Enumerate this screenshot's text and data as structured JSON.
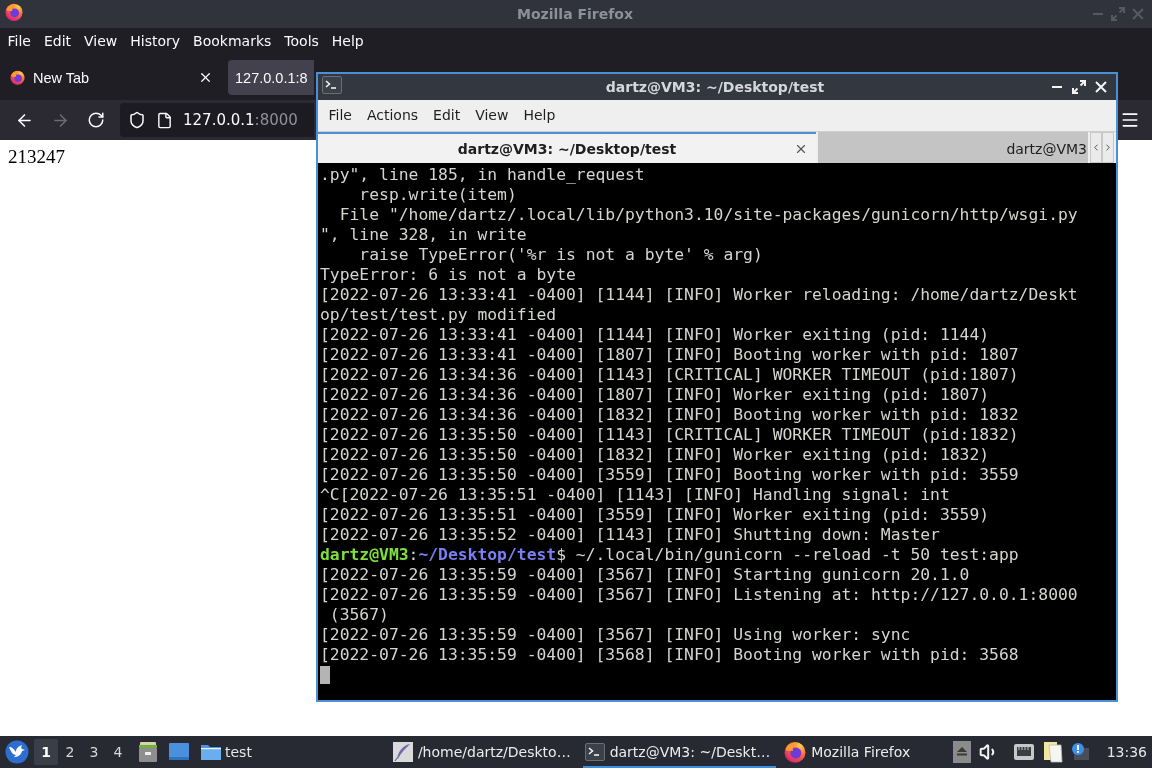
{
  "firefox": {
    "title": "Mozilla Firefox",
    "menu": [
      "File",
      "Edit",
      "View",
      "History",
      "Bookmarks",
      "Tools",
      "Help"
    ],
    "tabs": [
      {
        "label": "New Tab",
        "selected": false,
        "close_button": true
      },
      {
        "label": "127.0.0.1:8",
        "selected": true,
        "close_button": false
      }
    ],
    "nav": {
      "back": {
        "disabled": false
      },
      "forward": {
        "disabled": true
      },
      "url": {
        "host": "127.0.0.1",
        "port": ":8000"
      }
    },
    "page": {
      "text": "213247"
    }
  },
  "terminal": {
    "title": "dartz@VM3: ~/Desktop/test",
    "menu": [
      "File",
      "Actions",
      "Edit",
      "View",
      "Help"
    ],
    "tabs": [
      {
        "label": "dartz@VM3: ~/Desktop/test",
        "selected": true,
        "close_button": true
      },
      {
        "label": "dartz@VM3",
        "selected": false,
        "close_button": false
      }
    ],
    "lines": [
      {
        "kind": "output",
        "text": ".py\", line 185, in handle_request"
      },
      {
        "kind": "output",
        "text": "    resp.write(item)"
      },
      {
        "kind": "output",
        "text": "  File \"/home/dartz/.local/lib/python3.10/site-packages/gunicorn/http/wsgi.py"
      },
      {
        "kind": "output",
        "text": "\", line 328, in write"
      },
      {
        "kind": "output",
        "text": "    raise TypeError('%r is not a byte' % arg)"
      },
      {
        "kind": "output",
        "text": "TypeError: 6 is not a byte"
      },
      {
        "kind": "output",
        "text": "[2022-07-26 13:33:41 -0400] [1144] [INFO] Worker reloading: /home/dartz/Deskt"
      },
      {
        "kind": "output",
        "text": "op/test/test.py modified"
      },
      {
        "kind": "output",
        "text": "[2022-07-26 13:33:41 -0400] [1144] [INFO] Worker exiting (pid: 1144)"
      },
      {
        "kind": "output",
        "text": "[2022-07-26 13:33:41 -0400] [1807] [INFO] Booting worker with pid: 1807"
      },
      {
        "kind": "output",
        "text": "[2022-07-26 13:34:36 -0400] [1143] [CRITICAL] WORKER TIMEOUT (pid:1807)"
      },
      {
        "kind": "output",
        "text": "[2022-07-26 13:34:36 -0400] [1807] [INFO] Worker exiting (pid: 1807)"
      },
      {
        "kind": "output",
        "text": "[2022-07-26 13:34:36 -0400] [1832] [INFO] Booting worker with pid: 1832"
      },
      {
        "kind": "output",
        "text": "[2022-07-26 13:35:50 -0400] [1143] [CRITICAL] WORKER TIMEOUT (pid:1832)"
      },
      {
        "kind": "output",
        "text": "[2022-07-26 13:35:50 -0400] [1832] [INFO] Worker exiting (pid: 1832)"
      },
      {
        "kind": "output",
        "text": "[2022-07-26 13:35:50 -0400] [3559] [INFO] Booting worker with pid: 3559"
      },
      {
        "kind": "output",
        "text": "^C[2022-07-26 13:35:51 -0400] [1143] [INFO] Handling signal: int"
      },
      {
        "kind": "output",
        "text": "[2022-07-26 13:35:51 -0400] [3559] [INFO] Worker exiting (pid: 3559)"
      },
      {
        "kind": "output",
        "text": "[2022-07-26 13:35:52 -0400] [1143] [INFO] Shutting down: Master"
      },
      {
        "kind": "prompt",
        "user": "dartz@VM3",
        "separator": ":",
        "path": "~/Desktop/test",
        "command": "$ ~/.local/bin/gunicorn --reload -t 50 test:app"
      },
      {
        "kind": "output",
        "text": "[2022-07-26 13:35:59 -0400] [3567] [INFO] Starting gunicorn 20.1.0"
      },
      {
        "kind": "output",
        "text": "[2022-07-26 13:35:59 -0400] [3567] [INFO] Listening at: http://127.0.0.1:8000"
      },
      {
        "kind": "output",
        "text": " (3567)"
      },
      {
        "kind": "output",
        "text": "[2022-07-26 13:35:59 -0400] [3567] [INFO] Using worker: sync"
      },
      {
        "kind": "output",
        "text": "[2022-07-26 13:35:59 -0400] [3568] [INFO] Booting worker with pid: 3568"
      }
    ],
    "cursor": true
  },
  "taskbar": {
    "workspaces": [
      {
        "label": "1",
        "selected": true
      },
      {
        "label": "2",
        "selected": false
      },
      {
        "label": "3",
        "selected": false
      },
      {
        "label": "4",
        "selected": false
      }
    ],
    "launchers": [
      {
        "kind": "cabinet"
      },
      {
        "kind": "desktop"
      },
      {
        "kind": "folder",
        "label": "test"
      }
    ],
    "tasks": [
      {
        "kind": "editor",
        "label": "/home/dartz/Deskto…",
        "selected": false
      },
      {
        "kind": "terminal",
        "label": "dartz@VM3: ~/Deskt…",
        "selected": true
      },
      {
        "kind": "browser",
        "label": "Mozilla Firefox",
        "selected": false
      }
    ],
    "tray": [
      {
        "kind": "eject"
      },
      {
        "kind": "volume"
      },
      {
        "kind": "network"
      },
      {
        "kind": "clipboard"
      },
      {
        "kind": "notification"
      }
    ],
    "clock": "13:36"
  }
}
